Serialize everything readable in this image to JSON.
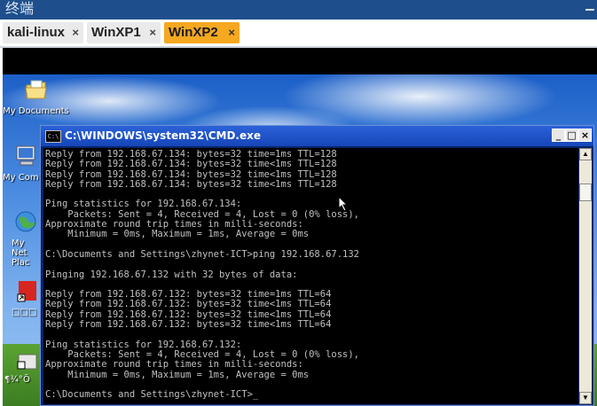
{
  "window": {
    "title": "终端"
  },
  "tabs": [
    {
      "label": "kali-linux",
      "close": "×"
    },
    {
      "label": "WinXP1",
      "close": "×"
    },
    {
      "label": "WinXP2",
      "close": "×"
    }
  ],
  "desktop_icons": [
    {
      "label": "My Documents"
    },
    {
      "label": "My Com"
    },
    {
      "label": "My Net Plac"
    },
    {
      "label": "□□□"
    },
    {
      "label": "¶¾°Õ"
    }
  ],
  "cmd": {
    "title": "C:\\WINDOWS\\system32\\CMD.exe",
    "icon_text": "C:\\",
    "minimize": "_",
    "maximize": "□",
    "close": "×",
    "scroll_up": "▲",
    "scroll_down": "▼",
    "lines": [
      "Reply from 192.168.67.134: bytes=32 time=1ms TTL=128",
      "Reply from 192.168.67.134: bytes=32 time<1ms TTL=128",
      "Reply from 192.168.67.134: bytes=32 time<1ms TTL=128",
      "Reply from 192.168.67.134: bytes=32 time<1ms TTL=128",
      "",
      "Ping statistics for 192.168.67.134:",
      "    Packets: Sent = 4, Received = 4, Lost = 0 (0% loss),",
      "Approximate round trip times in milli-seconds:",
      "    Minimum = 0ms, Maximum = 1ms, Average = 0ms",
      "",
      "C:\\Documents and Settings\\zhynet-ICT>ping 192.168.67.132",
      "",
      "Pinging 192.168.67.132 with 32 bytes of data:",
      "",
      "Reply from 192.168.67.132: bytes=32 time=1ms TTL=64",
      "Reply from 192.168.67.132: bytes=32 time<1ms TTL=64",
      "Reply from 192.168.67.132: bytes=32 time<1ms TTL=64",
      "Reply from 192.168.67.132: bytes=32 time<1ms TTL=64",
      "",
      "Ping statistics for 192.168.67.132:",
      "    Packets: Sent = 4, Received = 4, Lost = 0 (0% loss),",
      "Approximate round trip times in milli-seconds:",
      "    Minimum = 0ms, Maximum = 1ms, Average = 0ms",
      "",
      "C:\\Documents and Settings\\zhynet-ICT>_"
    ]
  }
}
